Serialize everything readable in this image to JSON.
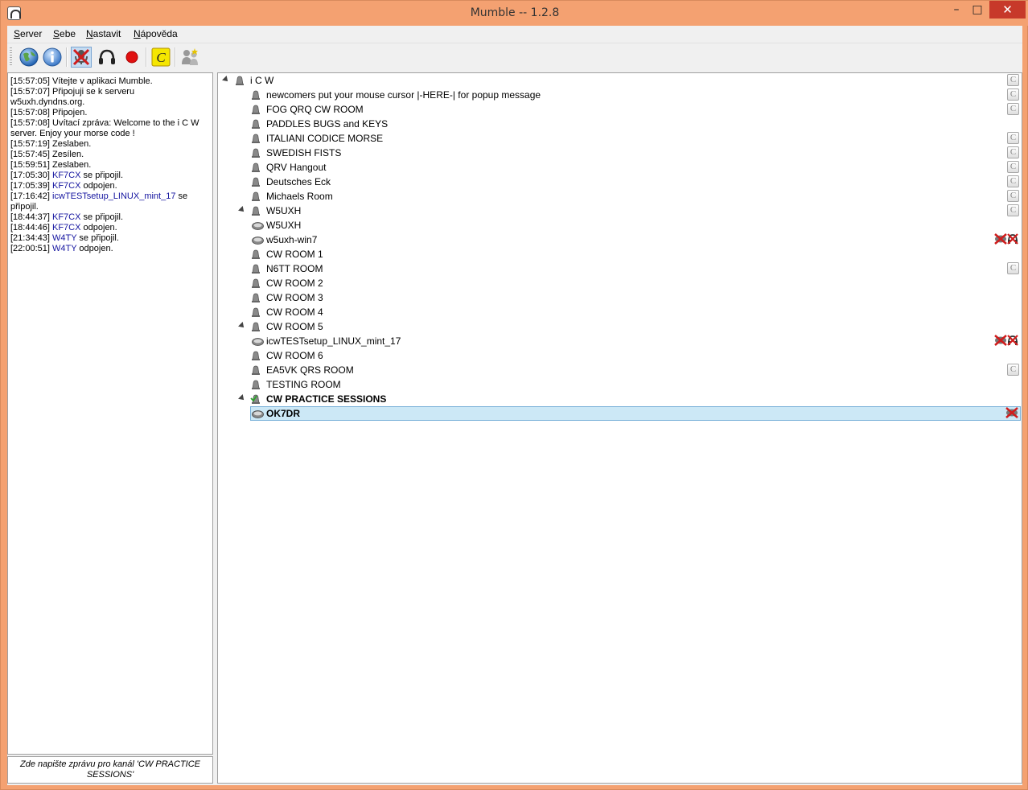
{
  "window": {
    "title": "Mumble -- 1.2.8",
    "minimize_glyph": "–",
    "maximize_glyph": "□",
    "close_glyph": "✕"
  },
  "menu": [
    {
      "label": "Server",
      "accel": "S",
      "rest": "erver"
    },
    {
      "label": "Sebe",
      "accel": "S",
      "rest": "ebe"
    },
    {
      "label": "Nastavit",
      "accel": "N",
      "rest": "astavit"
    },
    {
      "label": "Nápověda",
      "accel": "N",
      "rest": "ápověda"
    }
  ],
  "toolbar": [
    {
      "name": "connect-globe-icon"
    },
    {
      "name": "info-icon"
    },
    {
      "name": "mute-self-icon",
      "active": true
    },
    {
      "name": "deafen-headphones-icon"
    },
    {
      "name": "record-icon"
    },
    {
      "name": "comment-icon"
    },
    {
      "name": "audio-wizard-icon"
    }
  ],
  "log": [
    {
      "time": "[15:57:05]",
      "text": " Vítejte v aplikaci Mumble."
    },
    {
      "time": "[15:57:07]",
      "text": " Připojuji se k serveru w5uxh.dyndns.org."
    },
    {
      "time": "[15:57:08]",
      "text": " Připojen."
    },
    {
      "time": "[15:57:08]",
      "text": " Uvítací zpráva: Welcome to the i C W server. Enjoy your morse code !"
    },
    {
      "time": "[15:57:19]",
      "text": " Zeslaben."
    },
    {
      "time": "[15:57:45]",
      "text": " Zesílen."
    },
    {
      "time": "[15:59:51]",
      "text": " Zeslaben."
    },
    {
      "time": "[17:05:30]",
      "user": "KF7CX",
      "text": " se připojil."
    },
    {
      "time": "[17:05:39]",
      "user": "KF7CX",
      "text": " odpojen."
    },
    {
      "time": "[17:16:42]",
      "user": "icwTESTsetup_LINUX_mint_17",
      "text": " se připojil."
    },
    {
      "time": "[18:44:37]",
      "user": "KF7CX",
      "text": " se připojil."
    },
    {
      "time": "[18:44:46]",
      "user": "KF7CX",
      "text": " odpojen."
    },
    {
      "time": "[21:34:43]",
      "user": "W4TY",
      "text": " se připojil."
    },
    {
      "time": "[22:00:51]",
      "user": "W4TY",
      "text": " odpojen."
    }
  ],
  "chat_placeholder": "Zde napište zprávu pro kanál 'CW PRACTICE SESSIONS'",
  "tree": [
    {
      "type": "channel",
      "level": 0,
      "label": "i C W",
      "expanded": true,
      "comment": true
    },
    {
      "type": "channel",
      "level": 1,
      "label": "newcomers put your mouse cursor |-HERE-|  for popup message",
      "comment": true
    },
    {
      "type": "channel",
      "level": 1,
      "label": "FOG QRQ CW ROOM",
      "comment": true
    },
    {
      "type": "channel",
      "level": 1,
      "label": "PADDLES BUGS and KEYS",
      "comment": false
    },
    {
      "type": "channel",
      "level": 1,
      "label": "ITALIANI CODICE MORSE",
      "comment": true
    },
    {
      "type": "channel",
      "level": 1,
      "label": "SWEDISH FISTS",
      "comment": true
    },
    {
      "type": "channel",
      "level": 1,
      "label": "QRV Hangout",
      "comment": true
    },
    {
      "type": "channel",
      "level": 1,
      "label": "Deutsches Eck",
      "comment": true
    },
    {
      "type": "channel",
      "level": 1,
      "label": "Michaels Room",
      "comment": true
    },
    {
      "type": "channel",
      "level": 1,
      "label": "W5UXH",
      "expanded": true,
      "comment": true
    },
    {
      "type": "user",
      "level": 2,
      "label": "W5UXH"
    },
    {
      "type": "user",
      "level": 2,
      "label": "w5uxh-win7",
      "muted": true,
      "deafened": true
    },
    {
      "type": "channel",
      "level": 1,
      "label": "CW ROOM 1"
    },
    {
      "type": "channel",
      "level": 1,
      "label": "N6TT ROOM",
      "comment": true
    },
    {
      "type": "channel",
      "level": 1,
      "label": "CW ROOM 2"
    },
    {
      "type": "channel",
      "level": 1,
      "label": "CW ROOM 3"
    },
    {
      "type": "channel",
      "level": 1,
      "label": "CW ROOM 4"
    },
    {
      "type": "channel",
      "level": 1,
      "label": "CW ROOM 5",
      "expanded": true
    },
    {
      "type": "user",
      "level": 2,
      "label": "icwTESTsetup_LINUX_mint_17",
      "muted": true,
      "deafened": true
    },
    {
      "type": "channel",
      "level": 1,
      "label": "CW ROOM 6"
    },
    {
      "type": "channel",
      "level": 1,
      "label": "EA5VK QRS ROOM",
      "comment": true
    },
    {
      "type": "channel",
      "level": 1,
      "label": "TESTING ROOM"
    },
    {
      "type": "channel",
      "level": 1,
      "label": "CW PRACTICE SESSIONS",
      "expanded": true,
      "current": true,
      "bold": true
    },
    {
      "type": "user",
      "level": 2,
      "label": "OK7DR",
      "selected": true,
      "bold": true,
      "muted": true
    }
  ]
}
